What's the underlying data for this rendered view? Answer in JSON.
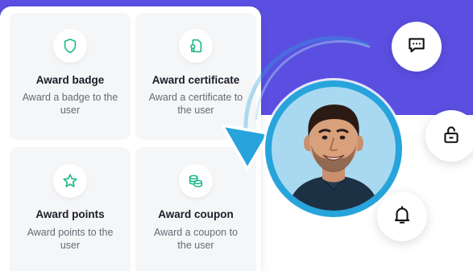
{
  "colors": {
    "brand_purple": "#5b4fe1",
    "accent_blue": "#27a4dc",
    "icon_green": "#1fb98b",
    "card_bg": "#f5f6f8"
  },
  "cards": [
    {
      "title": "Award badge",
      "description": "Award a badge to the user",
      "icon": "shield-icon"
    },
    {
      "title": "Award certificate",
      "description": "Award a certificate to the user",
      "icon": "certificate-icon"
    },
    {
      "title": "Award points",
      "description": "Award points to the user",
      "icon": "star-icon"
    },
    {
      "title": "Award coupon",
      "description": "Award a coupon to the user",
      "icon": "coins-icon"
    }
  ],
  "actions": {
    "chat": {
      "icon": "chat-bubble-icon"
    },
    "lock": {
      "icon": "unlock-icon"
    },
    "bell": {
      "icon": "bell-icon"
    }
  },
  "avatar": {
    "icon": "user-avatar-photo"
  }
}
